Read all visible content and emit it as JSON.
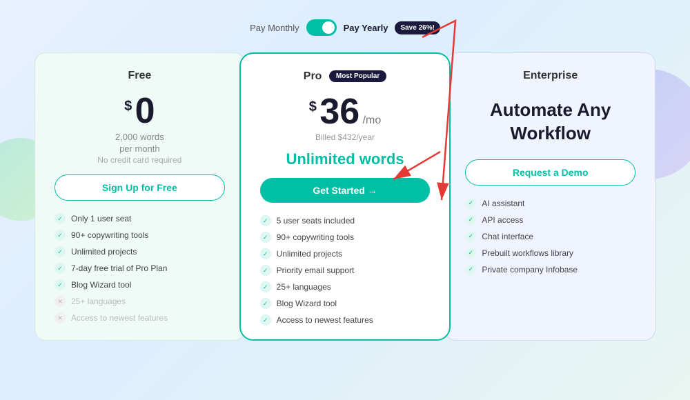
{
  "toggle": {
    "pay_monthly": "Pay Monthly",
    "pay_yearly": "Pay Yearly",
    "save_badge": "Save 26%!"
  },
  "cards": {
    "free": {
      "title": "Free",
      "price_currency": "$",
      "price_amount": "0",
      "words_line1": "2,000 words",
      "words_line2": "per month",
      "no_credit": "No credit card required",
      "btn_label": "Sign Up for Free",
      "features": [
        {
          "text": "Only 1 user seat",
          "enabled": true
        },
        {
          "text": "90+ copywriting tools",
          "enabled": true
        },
        {
          "text": "Unlimited projects",
          "enabled": true
        },
        {
          "text": "7-day free trial of Pro Plan",
          "enabled": true
        },
        {
          "text": "Blog Wizard tool",
          "enabled": true
        },
        {
          "text": "25+ languages",
          "enabled": false
        },
        {
          "text": "Access to newest features",
          "enabled": false
        }
      ]
    },
    "pro": {
      "title": "Pro",
      "badge": "Most Popular",
      "price_currency": "$",
      "price_amount": "36",
      "price_period": "/mo",
      "billed": "Billed $432/year",
      "unlimited_words": "Unlimited words",
      "btn_label": "Get Started →",
      "features": [
        {
          "text": "5 user seats included",
          "enabled": true
        },
        {
          "text": "90+ copywriting tools",
          "enabled": true
        },
        {
          "text": "Unlimited projects",
          "enabled": true
        },
        {
          "text": "Priority email support",
          "enabled": true
        },
        {
          "text": "25+ languages",
          "enabled": true
        },
        {
          "text": "Blog Wizard tool",
          "enabled": true
        },
        {
          "text": "Access to newest features",
          "enabled": true
        }
      ]
    },
    "enterprise": {
      "title": "Enterprise",
      "headline": "Automate Any Workflow",
      "btn_label": "Request a Demo",
      "features": [
        {
          "text": "AI assistant",
          "enabled": true
        },
        {
          "text": "API access",
          "enabled": true
        },
        {
          "text": "Chat interface",
          "enabled": true
        },
        {
          "text": "Prebuilt workflows library",
          "enabled": true
        },
        {
          "text": "Private company Infobase",
          "enabled": true
        }
      ]
    }
  },
  "colors": {
    "teal": "#00bfa5",
    "dark": "#1a1a2e",
    "badge_bg": "#1a1a3e"
  }
}
